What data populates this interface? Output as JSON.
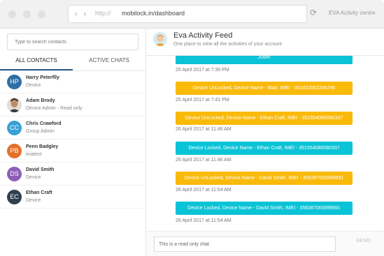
{
  "browser": {
    "url_protocol": "http://",
    "url": "mobilock.in/dashboard",
    "back_icon": "chevron-left-icon",
    "forward_icon": "chevron-right-icon",
    "reload_icon": "reload-icon",
    "tab_title": "EVA Activity centre"
  },
  "sidebar": {
    "search_placeholder": "Type to search contacts",
    "tabs": [
      {
        "label": "ALL CONTACTS",
        "active": true
      },
      {
        "label": "ACTIVE CHATS",
        "active": false
      }
    ],
    "contacts": [
      {
        "initials": "HP",
        "name": "Harry Peterflly",
        "role": "Device",
        "color": "#2f6fa6"
      },
      {
        "initials": "",
        "name": "Adam Brody",
        "role": "Device Admin - Read only",
        "color": "#d9d2cc"
      },
      {
        "initials": "CC",
        "name": "Chris Crawford",
        "role": "Group Admin",
        "color": "#3aa0d6"
      },
      {
        "initials": "PB",
        "name": "Penn Badgley",
        "role": "evatest",
        "color": "#e5702a"
      },
      {
        "initials": "DS",
        "name": "David Smith",
        "role": "Device",
        "color": "#8d5fb8"
      },
      {
        "initials": "EC",
        "name": "Ethan Craft",
        "role": "Device",
        "color": "#2f3f4f"
      }
    ]
  },
  "feed": {
    "title": "Eva Activity Feed",
    "subtitle": "One place to view all the activities of your account",
    "items": [
      {
        "type": "locked",
        "text": "Justin",
        "time": "25 April 2017 at 7:30 PM"
      },
      {
        "type": "unlocked",
        "text": "Device UnLocked, Device Name - Blair, IMEI - 351832062245296",
        "time": "25 April 2017 at 7:41 PM"
      },
      {
        "type": "unlocked",
        "text": "Device UnLocked, Device Name - Ethan Craft, IMEI - 351554080080337",
        "time": "26 April 2017 at 11:46 AM"
      },
      {
        "type": "locked",
        "text": "Device Locked, Device Name - Ethan Craft, IMEI - 351554080080337",
        "time": "26 April 2017 at 11:46 AM"
      },
      {
        "type": "unlocked",
        "text": "Device UnLocked, Device Name - David Smith, IMEI - 358387065899691",
        "time": "26 April 2017 at 11:54 AM"
      },
      {
        "type": "locked",
        "text": "Device Locked, Device Name - David Smith, IMEI - 358387065899691",
        "time": "26 April 2017 at 11:54 AM"
      }
    ],
    "colors": {
      "locked": "#0ac3d6",
      "unlocked": "#f9ba0b"
    }
  },
  "compose": {
    "placeholder": "This is a read only chat",
    "send_label": "SEND"
  }
}
